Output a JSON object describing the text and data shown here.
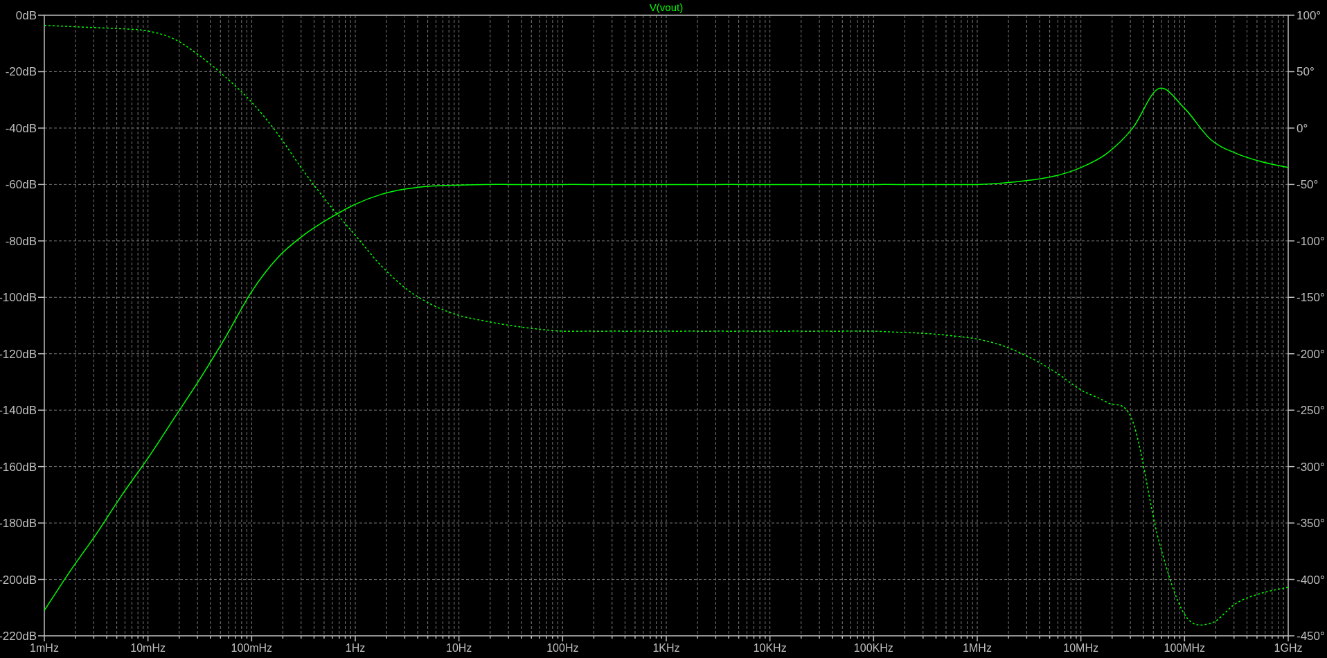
{
  "chart_data": {
    "type": "line",
    "title": "V(vout)",
    "grid": true,
    "categories": [
      "1mHz",
      null,
      null,
      null,
      "10mHz",
      null,
      null,
      null,
      "100mHz",
      null,
      null,
      null,
      "1Hz",
      null,
      null,
      null,
      "10Hz",
      null,
      null,
      null,
      "100Hz",
      null,
      null,
      null,
      "1KHz",
      null,
      null,
      null,
      "10KHz",
      null,
      null,
      null,
      "100KHz",
      null,
      null,
      null,
      "1MHz",
      null,
      null,
      null,
      "10MHz",
      null,
      null,
      null,
      "100MHz",
      null,
      null,
      null,
      "1GHz"
    ],
    "series": [
      {
        "color": "#00ff00",
        "values": [
          -211,
          -197,
          -184,
          -170,
          -157,
          -143,
          -129,
          -114,
          -98,
          -86,
          -78,
          -72,
          -67,
          -63.5,
          -61.5,
          -60.5,
          -60.2,
          -60,
          -60,
          -60,
          -60,
          -60,
          -60,
          -60,
          -60,
          -60,
          -60,
          -60,
          -60,
          -60,
          -60,
          -60,
          -60,
          -60,
          -60,
          -60,
          -60,
          -59.5,
          -58.5,
          -57,
          -54,
          -49,
          -40,
          -26,
          -33,
          -44,
          -49,
          -52,
          -54
        ]
      },
      {
        "color": "#00ff00",
        "axis": "y2",
        "line_style": "dashed",
        "values": [
          91,
          90,
          89,
          88,
          86,
          79,
          64,
          45,
          23,
          -5,
          -38,
          -68,
          -95,
          -122,
          -143,
          -157,
          -166,
          -171,
          -175,
          -178,
          -180,
          -180,
          -180,
          -180,
          -180,
          -180,
          -180,
          -180,
          -180,
          -180,
          -180,
          -180,
          -180,
          -181,
          -182,
          -184,
          -187,
          -193,
          -203,
          -216,
          -232,
          -243,
          -260,
          -365,
          -431,
          -439,
          -421,
          -412,
          -407
        ]
      }
    ],
    "ylim": [
      -220,
      0
    ],
    "y2lim": [
      -450,
      100
    ],
    "yticks": [
      {
        "value": 0,
        "label": "0dB"
      },
      {
        "value": -20,
        "label": "-20dB"
      },
      {
        "value": -40,
        "label": "-40dB"
      },
      {
        "value": -60,
        "label": "-60dB"
      },
      {
        "value": -80,
        "label": "-80dB"
      },
      {
        "value": -100,
        "label": "-100dB"
      },
      {
        "value": -120,
        "label": "-120dB"
      },
      {
        "value": -140,
        "label": "-140dB"
      },
      {
        "value": -160,
        "label": "-160dB"
      },
      {
        "value": -180,
        "label": "-180dB"
      },
      {
        "value": -200,
        "label": "-200dB"
      },
      {
        "value": -220,
        "label": "-220dB"
      }
    ],
    "y2ticks": [
      {
        "value": 100,
        "label": "100°"
      },
      {
        "value": 50,
        "label": "50°"
      },
      {
        "value": 0,
        "label": "0°"
      },
      {
        "value": -50,
        "label": "-50°"
      },
      {
        "value": -100,
        "label": "-100°"
      },
      {
        "value": -150,
        "label": "-150°"
      },
      {
        "value": -200,
        "label": "-200°"
      },
      {
        "value": -250,
        "label": "-250°"
      },
      {
        "value": -300,
        "label": "-300°"
      },
      {
        "value": -350,
        "label": "-350°"
      },
      {
        "value": -400,
        "label": "-400°"
      },
      {
        "value": -450,
        "label": "-450°"
      }
    ]
  }
}
